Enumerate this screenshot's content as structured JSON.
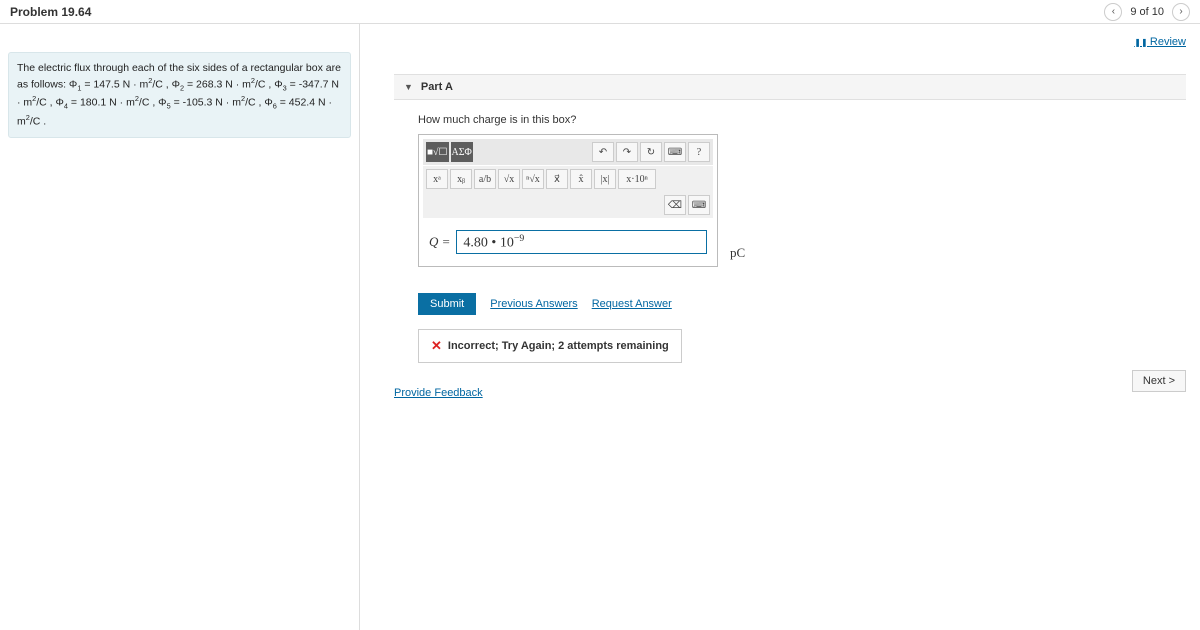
{
  "header": {
    "title": "Problem 19.64",
    "page_indicator": "9 of 10"
  },
  "review_label": "Review",
  "problem": {
    "statement_html": "The electric flux through each of the six sides of a rectangular box are as follows: Φ₁ = 147.5 N · m²/C , Φ₂ = 268.3 N · m²/C , Φ₃ = -347.7 N · m²/C , Φ₄ = 180.1 N · m²/C , Φ₅ = -105.3 N · m²/C , Φ₆ = 452.4 N · m²/C ."
  },
  "part": {
    "label": "Part A",
    "prompt": "How much charge is in this box?",
    "variable_label": "Q =",
    "answer_value": "4.80 • 10⁻⁹",
    "unit": "pC"
  },
  "toolbar": {
    "templates_icon": "■√☐",
    "greek": "ΑΣΦ",
    "undo": "↶",
    "redo": "↷",
    "reset": "↻",
    "keyboard": "⌨",
    "help": "?",
    "xa": "xᵃ",
    "xb": "xᵦ",
    "frac": "a/b",
    "sqrt": "√x",
    "nroot": "ⁿ√x",
    "vec": "x⃗",
    "hat": "x̂",
    "abs": "|x|",
    "sci": "x·10ⁿ",
    "backspace": "⌫",
    "kb2": "⌨"
  },
  "actions": {
    "submit": "Submit",
    "previous": "Previous Answers",
    "request": "Request Answer"
  },
  "feedback": {
    "icon": "✕",
    "text": "Incorrect; Try Again; 2 attempts remaining"
  },
  "footer": {
    "provide_feedback": "Provide Feedback",
    "next": "Next >"
  }
}
